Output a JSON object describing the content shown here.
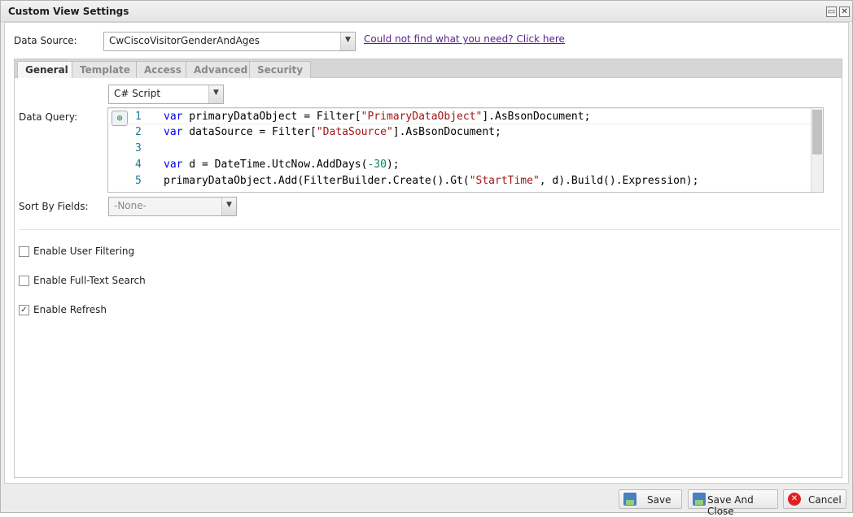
{
  "window": {
    "title": "Custom View Settings"
  },
  "data_source": {
    "label": "Data Source:",
    "value": "CwCiscoVisitorGenderAndAges",
    "help_link": "Could not find what you need? Click here"
  },
  "tabs": [
    {
      "label": "General",
      "active": true
    },
    {
      "label": "Template"
    },
    {
      "label": "Access"
    },
    {
      "label": "Advanced"
    },
    {
      "label": "Security"
    }
  ],
  "query": {
    "label": "Data Query:",
    "language": "C# Script",
    "lines": [
      {
        "n": "1",
        "tokens": [
          [
            "kw",
            "var"
          ],
          [
            "",
            "  primaryDataObject = Filter["
          ],
          [
            "str",
            "\"PrimaryDataObject\""
          ],
          [
            "",
            "].AsBsonDocument;"
          ]
        ]
      },
      {
        "n": "2",
        "tokens": [
          [
            "kw",
            "var"
          ],
          [
            "",
            "  dataSource = Filter["
          ],
          [
            "str",
            "\"DataSource\""
          ],
          [
            "",
            "].AsBsonDocument;"
          ]
        ]
      },
      {
        "n": "3",
        "tokens": []
      },
      {
        "n": "4",
        "tokens": [
          [
            "kw",
            "var"
          ],
          [
            "",
            "  d = DateTime.UtcNow.AddDays("
          ],
          [
            "num",
            "-30"
          ],
          [
            "",
            ");"
          ]
        ]
      },
      {
        "n": "5",
        "tokens": [
          [
            "",
            "primaryDataObject.Add(FilterBuilder.Create().Gt("
          ],
          [
            "str",
            "\"StartTime\""
          ],
          [
            "",
            ", d).Build().Expression);"
          ]
        ]
      }
    ]
  },
  "sort": {
    "label": "Sort By Fields:",
    "value": "-None-"
  },
  "options": [
    {
      "label": "Enable User Filtering",
      "checked": false
    },
    {
      "label": "Enable Full-Text Search",
      "checked": false
    },
    {
      "label": "Enable Refresh",
      "checked": true
    }
  ],
  "buttons": {
    "save": "Save",
    "save_close": "Save And Close",
    "cancel": "Cancel"
  }
}
